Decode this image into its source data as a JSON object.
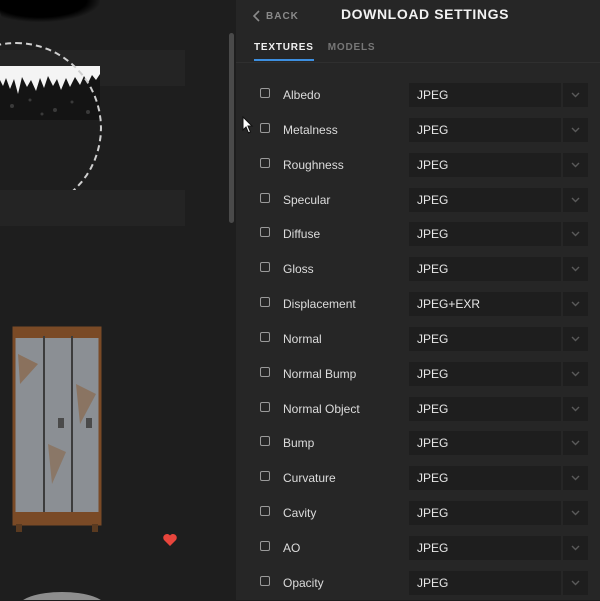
{
  "header": {
    "back_label": "BACK",
    "title": "DOWNLOAD SETTINGS"
  },
  "tabs": [
    {
      "label": "TEXTURES",
      "active": true
    },
    {
      "label": "MODELS",
      "active": false
    }
  ],
  "textures": [
    {
      "label": "Albedo",
      "format": "JPEG",
      "checked": false
    },
    {
      "label": "Metalness",
      "format": "JPEG",
      "checked": false
    },
    {
      "label": "Roughness",
      "format": "JPEG",
      "checked": false
    },
    {
      "label": "Specular",
      "format": "JPEG",
      "checked": false
    },
    {
      "label": "Diffuse",
      "format": "JPEG",
      "checked": false
    },
    {
      "label": "Gloss",
      "format": "JPEG",
      "checked": false
    },
    {
      "label": "Displacement",
      "format": "JPEG+EXR",
      "checked": false
    },
    {
      "label": "Normal",
      "format": "JPEG",
      "checked": false
    },
    {
      "label": "Normal Bump",
      "format": "JPEG",
      "checked": false
    },
    {
      "label": "Normal Object",
      "format": "JPEG",
      "checked": false
    },
    {
      "label": "Bump",
      "format": "JPEG",
      "checked": false
    },
    {
      "label": "Curvature",
      "format": "JPEG",
      "checked": false
    },
    {
      "label": "Cavity",
      "format": "JPEG",
      "checked": false
    },
    {
      "label": "AO",
      "format": "JPEG",
      "checked": false
    },
    {
      "label": "Opacity",
      "format": "JPEG",
      "checked": false
    }
  ],
  "icons": {
    "back": "chevron-left-icon",
    "dropdown": "chevron-down-icon",
    "favorite": "heart-icon",
    "cursor": "mouse-pointer-icon"
  },
  "colors": {
    "accent": "#3d8fe0",
    "favorite": "#e8453c",
    "panel_bg": "#262626"
  }
}
